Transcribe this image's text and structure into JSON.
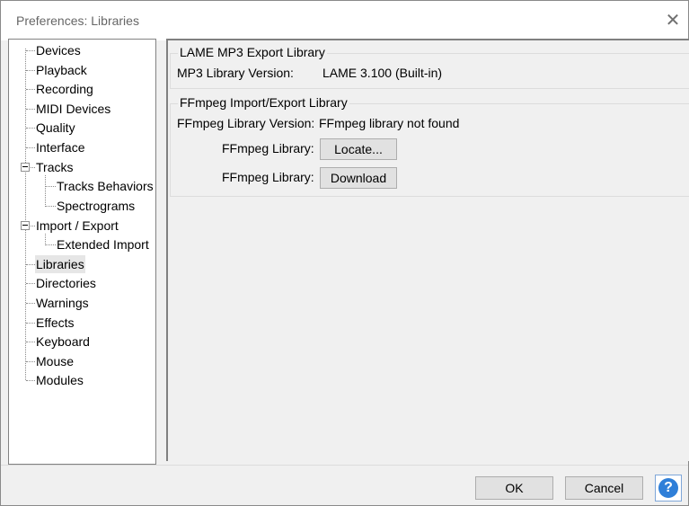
{
  "window": {
    "title": "Preferences: Libraries"
  },
  "tree": {
    "items": [
      {
        "label": "Devices"
      },
      {
        "label": "Playback"
      },
      {
        "label": "Recording"
      },
      {
        "label": "MIDI Devices"
      },
      {
        "label": "Quality"
      },
      {
        "label": "Interface"
      },
      {
        "label": "Tracks"
      },
      {
        "label": "Tracks Behaviors"
      },
      {
        "label": "Spectrograms"
      },
      {
        "label": "Import / Export"
      },
      {
        "label": "Extended Import"
      },
      {
        "label": "Libraries"
      },
      {
        "label": "Directories"
      },
      {
        "label": "Warnings"
      },
      {
        "label": "Effects"
      },
      {
        "label": "Keyboard"
      },
      {
        "label": "Mouse"
      },
      {
        "label": "Modules"
      }
    ],
    "selected": "Libraries"
  },
  "lame": {
    "group_title": "LAME MP3 Export Library",
    "version_label": "MP3 Library Version:",
    "version_value": "LAME 3.100 (Built-in)"
  },
  "ffmpeg": {
    "group_title": "FFmpeg Import/Export Library",
    "version_label": "FFmpeg Library Version:",
    "version_value": "FFmpeg library not found",
    "locate_label": "FFmpeg Library:",
    "locate_button": "Locate...",
    "download_label": "FFmpeg Library:",
    "download_button": "Download"
  },
  "footer": {
    "ok_label": "OK",
    "cancel_label": "Cancel",
    "help_glyph": "?"
  },
  "icons": {
    "close": "close-icon",
    "help": "help-icon"
  }
}
